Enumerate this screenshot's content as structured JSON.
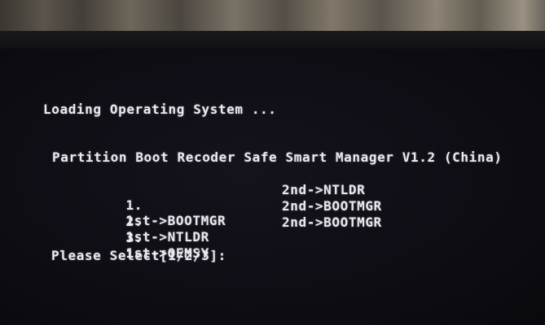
{
  "boot_screen": {
    "loading_text": "Loading Operating System ...",
    "manager_title": "Partition Boot Recoder Safe Smart Manager V1.2 (China)",
    "options": [
      {
        "number": "1.",
        "first": "1st->BOOTMGR",
        "second": "2nd->NTLDR"
      },
      {
        "number": "2.",
        "first": "1st->NTLDR",
        "second": "2nd->BOOTMGR"
      },
      {
        "number": "3.",
        "first": "1st->OEMSY",
        "second": "2nd->BOOTMGR"
      }
    ],
    "prompt": "Please Select[1/2/3]:"
  }
}
